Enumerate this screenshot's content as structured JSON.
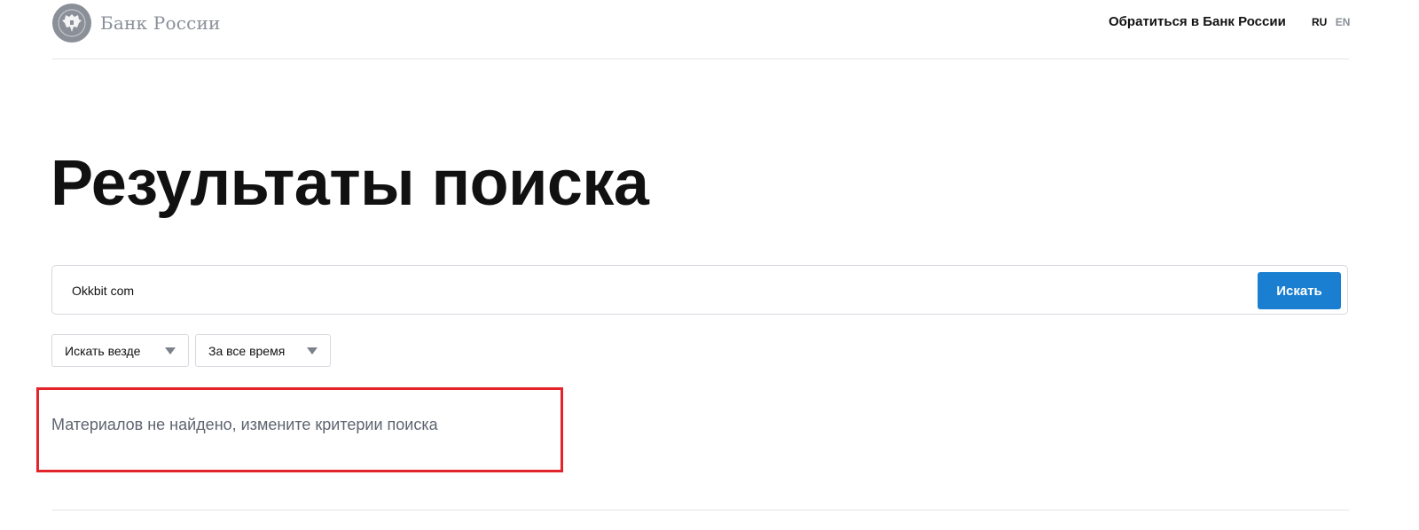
{
  "header": {
    "logo_text": "Банк России",
    "contact_link": "Обратиться в Банк России",
    "languages": {
      "ru": "RU",
      "en": "EN"
    }
  },
  "page": {
    "title": "Результаты поиска"
  },
  "search": {
    "value": "Okkbit com",
    "button_label": "Искать"
  },
  "filters": {
    "where": "Искать везде",
    "time": "За все время"
  },
  "results": {
    "empty_message": "Материалов не найдено, измените критерии поиска"
  },
  "colors": {
    "accent": "#1a7fd0",
    "highlight": "#e3242b",
    "muted": "#8a8f98"
  },
  "icons": {
    "logo": "double-headed-eagle-icon",
    "dropdown": "triangle-down-icon"
  }
}
